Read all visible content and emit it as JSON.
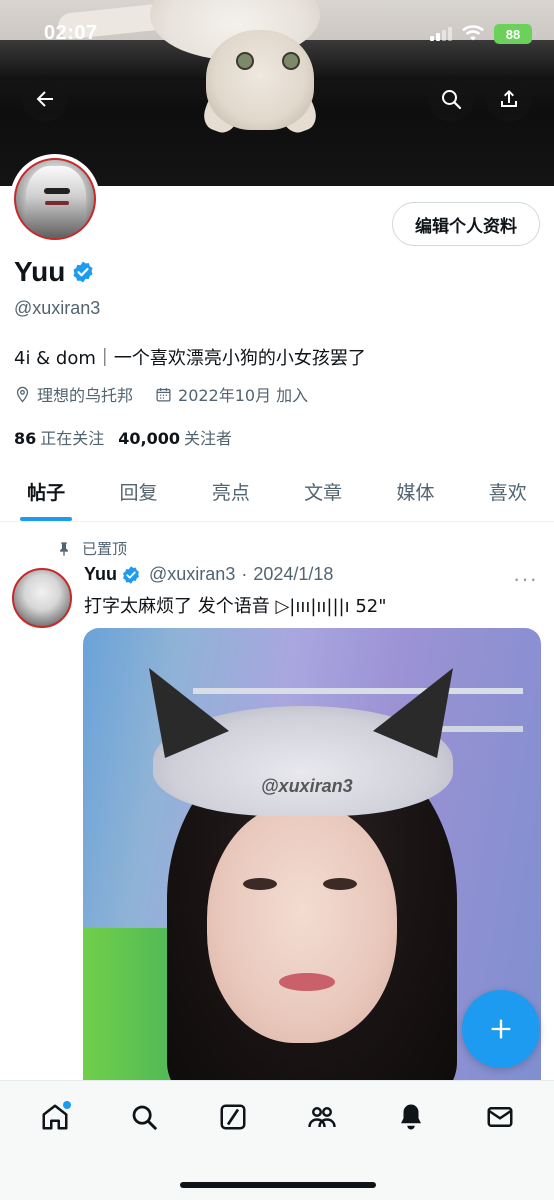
{
  "status_bar": {
    "time": "02:07",
    "battery": "88"
  },
  "profile": {
    "display_name": "Yuu",
    "handle": "@xuxiran3",
    "bio": "4i & dom｜一个喜欢漂亮小狗的小女孩罢了",
    "location": "理想的乌托邦",
    "joined": "2022年10月 加入",
    "following_count": "86",
    "following_label": "正在关注",
    "followers_count": "40,000",
    "followers_label": "关注者",
    "edit_button": "编辑个人资料"
  },
  "tabs": [
    {
      "label": "帖子",
      "active": true
    },
    {
      "label": "回复",
      "active": false
    },
    {
      "label": "亮点",
      "active": false
    },
    {
      "label": "文章",
      "active": false
    },
    {
      "label": "媒体",
      "active": false
    },
    {
      "label": "喜欢",
      "active": false
    }
  ],
  "post": {
    "pinned_label": "已置顶",
    "author_name": "Yuu",
    "author_handle": "@xuxiran3",
    "date_sep": "·",
    "date": "2024/1/18",
    "more": "···",
    "text": "打字太麻烦了 发个语音 ▷|ııı|ıı|||ı 52\"",
    "media_watermark": "@xuxiran3"
  },
  "icons": {
    "back": "arrow-left-icon",
    "search": "search-icon",
    "share": "share-icon",
    "location": "location-pin-icon",
    "calendar": "calendar-icon",
    "pin": "pin-icon",
    "compose": "plus-icon"
  },
  "colors": {
    "accent": "#1d9bf0",
    "text": "#0f1419",
    "muted": "#536471"
  }
}
